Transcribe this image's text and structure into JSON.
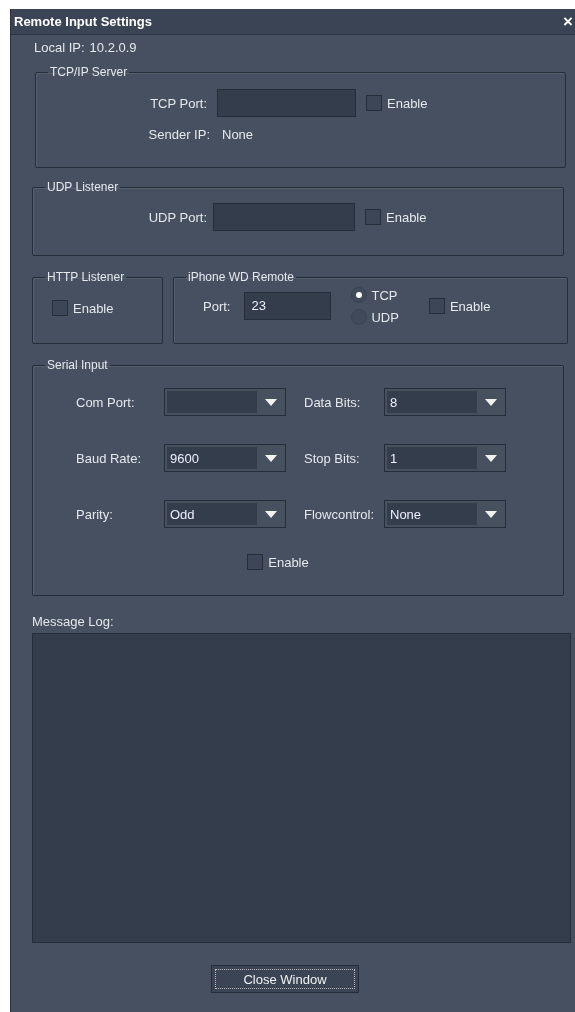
{
  "window": {
    "title": "Remote Input Settings",
    "close_glyph": "×"
  },
  "local_ip": {
    "label": "Local IP:",
    "value": "10.2.0.9"
  },
  "tcp_server": {
    "title": "TCP/IP Server",
    "port_label": "TCP Port:",
    "enable": {
      "label": "Enable",
      "checked": false
    },
    "sender_ip_label": "Sender IP:",
    "sender_ip_value": "None"
  },
  "udp_listener": {
    "title": "UDP Listener",
    "port_label": "UDP Port:",
    "enable": {
      "label": "Enable",
      "checked": false
    }
  },
  "http_listener": {
    "title": "HTTP Listener",
    "enable": {
      "label": "Enable",
      "checked": false
    }
  },
  "iphone_remote": {
    "title": "iPhone WD Remote",
    "port_label": "Port:",
    "port_value": "23",
    "protocols": [
      {
        "label": "TCP",
        "selected": true
      },
      {
        "label": "UDP",
        "selected": false
      }
    ],
    "enable": {
      "label": "Enable",
      "checked": false
    }
  },
  "serial_input": {
    "title": "Serial Input",
    "fields": [
      {
        "label": "Com Port:"
      },
      {
        "label": "Data Bits:",
        "value": "8"
      },
      {
        "label": "Baud Rate:",
        "value": "9600"
      },
      {
        "label": "Stop Bits:",
        "value": "1"
      },
      {
        "label": "Parity:",
        "value": "Odd"
      },
      {
        "label": "Flowcontrol:",
        "value": "None"
      }
    ],
    "enable": {
      "label": "Enable",
      "checked": false
    }
  },
  "message_log": {
    "label": "Message Log:"
  },
  "buttons": [
    {
      "label": "Close Window"
    }
  ]
}
